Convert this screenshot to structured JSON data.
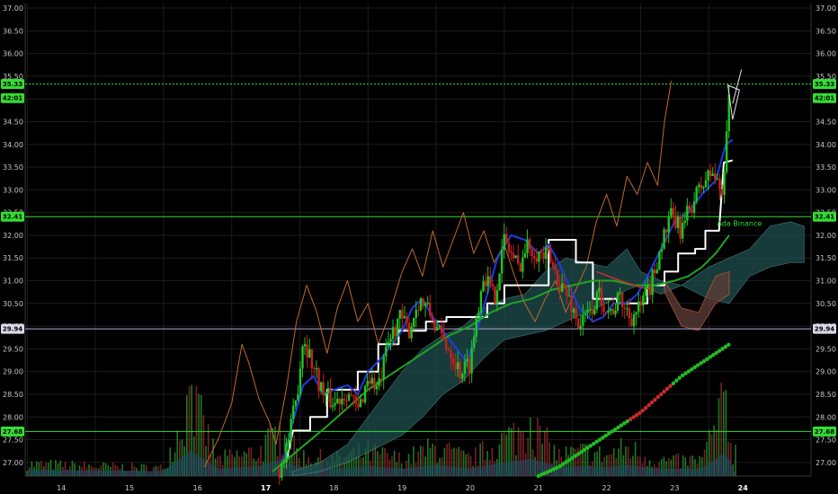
{
  "chart_data": {
    "type": "candlestick",
    "y_axis": {
      "range": [
        26.7,
        37.1
      ],
      "ticks": [
        "37.00",
        "36.50",
        "36.00",
        "35.50",
        "35.00",
        "34.50",
        "34.00",
        "33.50",
        "33.00",
        "32.50",
        "32.00",
        "31.50",
        "31.00",
        "30.50",
        "30.00",
        "29.50",
        "29.00",
        "28.50",
        "28.00",
        "27.50",
        "27.00"
      ]
    },
    "x_axis": {
      "range": [
        13.47,
        25.0
      ],
      "ticks": [
        {
          "label": "14",
          "x": 14,
          "bold": false
        },
        {
          "label": "15",
          "x": 15,
          "bold": false
        },
        {
          "label": "16",
          "x": 16,
          "bold": false
        },
        {
          "label": "17",
          "x": 17,
          "bold": true
        },
        {
          "label": "18",
          "x": 18,
          "bold": false
        },
        {
          "label": "19",
          "x": 19,
          "bold": false
        },
        {
          "label": "20",
          "x": 20,
          "bold": false
        },
        {
          "label": "21",
          "x": 21,
          "bold": false
        },
        {
          "label": "22",
          "x": 22,
          "bold": false
        },
        {
          "label": "23",
          "x": 23,
          "bold": false
        },
        {
          "label": "24",
          "x": 24,
          "bold": true
        }
      ]
    },
    "grid": true,
    "horizontal_lines": [
      {
        "name": "last-price-line",
        "y": 35.33,
        "color": "#33dd33",
        "dashed": true
      },
      {
        "name": "level-32-41",
        "y": 32.41,
        "color": "#33dd33",
        "dashed": false
      },
      {
        "name": "level-29-94",
        "y": 29.94,
        "color": "#b4a8d8",
        "dashed": false
      },
      {
        "name": "level-27-68",
        "y": 27.68,
        "color": "#33dd33",
        "dashed": false
      }
    ],
    "price_badges": [
      {
        "text": "35.33",
        "y": 35.33,
        "bg": "#33dd33",
        "fg": "#000000"
      },
      {
        "text": "42:01",
        "y": 35.02,
        "bg": "#33dd33",
        "fg": "#000000"
      },
      {
        "text": "32.41",
        "y": 32.41,
        "bg": "#33dd33",
        "fg": "#000000"
      },
      {
        "text": "29.94",
        "y": 29.94,
        "bg": "#d8d8e8",
        "fg": "#000000"
      },
      {
        "text": "27.68",
        "y": 27.68,
        "bg": "#33dd33",
        "fg": "#000000"
      }
    ],
    "annotation": {
      "text": "Ada Binance",
      "x": 23.62,
      "y": 32.27,
      "color": "#33dd33"
    },
    "candles_anchor": [
      [
        17.2,
        26.85
      ],
      [
        17.35,
        27.6
      ],
      [
        17.45,
        28.4
      ],
      [
        17.55,
        29.8
      ],
      [
        17.7,
        29.1
      ],
      [
        17.85,
        28.5
      ],
      [
        18.0,
        28.3
      ],
      [
        18.2,
        28.6
      ],
      [
        18.35,
        28.1
      ],
      [
        18.5,
        28.9
      ],
      [
        18.65,
        28.6
      ],
      [
        18.8,
        29.6
      ],
      [
        18.95,
        30.2
      ],
      [
        19.1,
        29.9
      ],
      [
        19.25,
        30.6
      ],
      [
        19.4,
        30.3
      ],
      [
        19.55,
        29.8
      ],
      [
        19.7,
        29.5
      ],
      [
        19.85,
        29.0
      ],
      [
        20.0,
        29.2
      ],
      [
        20.1,
        30.3
      ],
      [
        20.2,
        31.2
      ],
      [
        20.35,
        30.6
      ],
      [
        20.5,
        31.9
      ],
      [
        20.7,
        31.3
      ],
      [
        20.85,
        31.8
      ],
      [
        21.0,
        31.6
      ],
      [
        21.15,
        31.5
      ],
      [
        21.3,
        31.0
      ],
      [
        21.45,
        30.6
      ],
      [
        21.6,
        30.0
      ],
      [
        21.75,
        30.3
      ],
      [
        21.9,
        30.7
      ],
      [
        22.05,
        30.3
      ],
      [
        22.2,
        30.6
      ],
      [
        22.35,
        30.2
      ],
      [
        22.5,
        30.4
      ],
      [
        22.65,
        30.9
      ],
      [
        22.8,
        31.8
      ],
      [
        22.95,
        32.4
      ],
      [
        23.1,
        32.1
      ],
      [
        23.25,
        32.7
      ],
      [
        23.4,
        33.1
      ],
      [
        23.55,
        33.4
      ],
      [
        23.7,
        32.9
      ],
      [
        23.8,
        35.3
      ]
    ],
    "volume_anchor": [
      [
        13.5,
        0.15
      ],
      [
        14.5,
        0.12
      ],
      [
        15.5,
        0.1
      ],
      [
        15.9,
        0.95
      ],
      [
        16.3,
        0.2
      ],
      [
        16.9,
        0.3
      ],
      [
        17.2,
        0.55
      ],
      [
        17.5,
        0.25
      ],
      [
        18.0,
        0.2
      ],
      [
        18.5,
        0.3
      ],
      [
        19.0,
        0.2
      ],
      [
        19.5,
        0.35
      ],
      [
        20.0,
        0.2
      ],
      [
        20.5,
        0.45
      ],
      [
        20.9,
        0.6
      ],
      [
        21.3,
        0.25
      ],
      [
        21.7,
        0.3
      ],
      [
        22.0,
        0.25
      ],
      [
        22.3,
        0.35
      ],
      [
        22.7,
        0.2
      ],
      [
        23.0,
        0.18
      ],
      [
        23.4,
        0.2
      ],
      [
        23.75,
        0.9
      ],
      [
        23.85,
        0.3
      ]
    ],
    "series": [
      {
        "name": "",
        "color": "#c0692a",
        "width": 1,
        "points": [
          [
            16.1,
            26.9
          ],
          [
            16.3,
            27.5
          ],
          [
            16.5,
            28.3
          ],
          [
            16.65,
            29.6
          ],
          [
            16.75,
            29.2
          ],
          [
            16.9,
            28.4
          ],
          [
            17.05,
            27.9
          ],
          [
            17.15,
            27.4
          ],
          [
            17.3,
            28.6
          ],
          [
            17.45,
            30.1
          ],
          [
            17.6,
            30.9
          ],
          [
            17.75,
            30.3
          ],
          [
            17.9,
            29.4
          ],
          [
            18.05,
            30.4
          ],
          [
            18.2,
            31.0
          ],
          [
            18.35,
            30.1
          ],
          [
            18.5,
            30.5
          ],
          [
            18.65,
            29.6
          ],
          [
            18.8,
            30.2
          ],
          [
            19.0,
            31.2
          ],
          [
            19.15,
            31.7
          ],
          [
            19.3,
            31.1
          ],
          [
            19.45,
            32.1
          ],
          [
            19.6,
            31.3
          ],
          [
            19.75,
            31.9
          ],
          [
            19.9,
            32.5
          ],
          [
            20.05,
            31.6
          ],
          [
            20.2,
            32.1
          ],
          [
            20.35,
            31.4
          ],
          [
            20.5,
            31.8
          ],
          [
            20.65,
            31.1
          ],
          [
            20.8,
            30.5
          ],
          [
            20.95,
            30.1
          ],
          [
            21.1,
            30.6
          ],
          [
            21.25,
            31.0
          ],
          [
            21.4,
            30.3
          ],
          [
            21.55,
            30.8
          ],
          [
            21.7,
            31.3
          ],
          [
            21.85,
            32.3
          ],
          [
            22.0,
            32.9
          ],
          [
            22.15,
            32.2
          ],
          [
            22.3,
            33.3
          ],
          [
            22.45,
            32.9
          ],
          [
            22.6,
            33.6
          ],
          [
            22.75,
            33.1
          ],
          [
            22.85,
            34.5
          ],
          [
            22.95,
            35.4
          ]
        ]
      },
      {
        "name": "",
        "color": "#ffffff",
        "width": 2,
        "points": [
          [
            17.3,
            27.0
          ],
          [
            17.4,
            27.7
          ],
          [
            17.65,
            27.7
          ],
          [
            17.65,
            28.0
          ],
          [
            17.9,
            28.0
          ],
          [
            17.9,
            28.6
          ],
          [
            18.35,
            28.6
          ],
          [
            18.35,
            29.0
          ],
          [
            18.65,
            29.0
          ],
          [
            18.65,
            29.6
          ],
          [
            18.95,
            29.6
          ],
          [
            18.95,
            29.9
          ],
          [
            19.35,
            29.9
          ],
          [
            19.35,
            30.1
          ],
          [
            19.65,
            30.1
          ],
          [
            19.65,
            30.2
          ],
          [
            20.25,
            30.2
          ],
          [
            20.25,
            30.5
          ],
          [
            20.5,
            30.5
          ],
          [
            20.5,
            30.9
          ],
          [
            21.15,
            30.9
          ],
          [
            21.15,
            31.9
          ],
          [
            21.55,
            31.9
          ],
          [
            21.55,
            31.4
          ],
          [
            21.8,
            31.4
          ],
          [
            21.8,
            30.6
          ],
          [
            22.15,
            30.6
          ],
          [
            22.15,
            30.5
          ],
          [
            22.6,
            30.5
          ],
          [
            22.6,
            30.9
          ],
          [
            22.85,
            30.9
          ],
          [
            22.85,
            31.2
          ],
          [
            23.05,
            31.2
          ],
          [
            23.05,
            31.6
          ],
          [
            23.3,
            31.6
          ],
          [
            23.3,
            31.7
          ],
          [
            23.45,
            31.7
          ],
          [
            23.45,
            32.1
          ],
          [
            23.65,
            32.1
          ],
          [
            23.72,
            33.6
          ],
          [
            23.85,
            33.65
          ]
        ]
      },
      {
        "name": "",
        "color": "#1a3ce8",
        "width": 2,
        "points": [
          [
            17.25,
            27.0
          ],
          [
            17.4,
            27.9
          ],
          [
            17.55,
            28.7
          ],
          [
            17.7,
            28.9
          ],
          [
            17.85,
            28.5
          ],
          [
            18.0,
            28.6
          ],
          [
            18.2,
            28.7
          ],
          [
            18.35,
            28.5
          ],
          [
            18.5,
            29.0
          ],
          [
            18.7,
            29.3
          ],
          [
            18.85,
            29.6
          ],
          [
            19.0,
            29.9
          ],
          [
            19.15,
            30.4
          ],
          [
            19.3,
            30.6
          ],
          [
            19.45,
            30.2
          ],
          [
            19.6,
            29.9
          ],
          [
            19.8,
            29.5
          ],
          [
            19.95,
            29.2
          ],
          [
            20.1,
            29.9
          ],
          [
            20.25,
            30.7
          ],
          [
            20.4,
            31.5
          ],
          [
            20.6,
            32.0
          ],
          [
            20.8,
            31.9
          ],
          [
            21.0,
            31.6
          ],
          [
            21.15,
            31.8
          ],
          [
            21.3,
            31.4
          ],
          [
            21.45,
            30.9
          ],
          [
            21.6,
            30.4
          ],
          [
            21.8,
            30.1
          ],
          [
            21.95,
            30.2
          ],
          [
            22.1,
            30.5
          ],
          [
            22.3,
            30.5
          ],
          [
            22.45,
            30.7
          ],
          [
            22.6,
            31.1
          ],
          [
            22.8,
            31.7
          ],
          [
            23.0,
            32.3
          ],
          [
            23.2,
            32.5
          ],
          [
            23.4,
            32.9
          ],
          [
            23.6,
            33.2
          ],
          [
            23.75,
            34.0
          ],
          [
            23.85,
            34.1
          ]
        ]
      },
      {
        "name": "",
        "color": "#22a322",
        "width": 2,
        "points": [
          [
            17.1,
            26.8
          ],
          [
            17.5,
            27.3
          ],
          [
            17.9,
            27.8
          ],
          [
            18.2,
            28.2
          ],
          [
            18.5,
            28.6
          ],
          [
            18.8,
            28.9
          ],
          [
            19.1,
            29.2
          ],
          [
            19.4,
            29.5
          ],
          [
            19.7,
            29.8
          ],
          [
            20.0,
            30.0
          ],
          [
            20.3,
            30.3
          ],
          [
            20.6,
            30.5
          ],
          [
            20.9,
            30.6
          ],
          [
            21.2,
            30.8
          ],
          [
            21.5,
            30.9
          ],
          [
            21.8,
            31.0
          ],
          [
            22.1,
            31.0
          ],
          [
            22.4,
            30.9
          ],
          [
            22.7,
            30.9
          ],
          [
            23.0,
            31.0
          ],
          [
            23.2,
            31.1
          ],
          [
            23.4,
            31.3
          ],
          [
            23.6,
            31.6
          ],
          [
            23.8,
            32.0
          ]
        ]
      },
      {
        "name": "",
        "color": "#cc2b2b",
        "width": 1.5,
        "points": [
          [
            21.85,
            31.2
          ],
          [
            22.2,
            31.0
          ],
          [
            22.5,
            30.85
          ],
          [
            22.7,
            30.8
          ]
        ]
      }
    ],
    "dotted_series": {
      "colors": [
        "#22bb22",
        "#cc2b2b"
      ],
      "points": [
        [
          21.0,
          26.7
        ],
        [
          21.3,
          26.9
        ],
        [
          21.6,
          27.2
        ],
        [
          21.9,
          27.5
        ],
        [
          22.2,
          27.8
        ],
        [
          22.5,
          28.1
        ],
        [
          22.8,
          28.5
        ],
        [
          23.1,
          28.9
        ],
        [
          23.4,
          29.2
        ],
        [
          23.6,
          29.4
        ],
        [
          23.8,
          29.6
        ]
      ]
    },
    "cloud": {
      "upper": [
        [
          17.4,
          26.8
        ],
        [
          17.8,
          27.0
        ],
        [
          18.2,
          27.4
        ],
        [
          18.6,
          28.2
        ],
        [
          19.0,
          29.0
        ],
        [
          19.3,
          29.5
        ],
        [
          19.6,
          29.8
        ],
        [
          19.9,
          30.0
        ],
        [
          20.2,
          30.4
        ],
        [
          20.5,
          30.6
        ],
        [
          20.8,
          30.7
        ],
        [
          21.1,
          31.2
        ],
        [
          21.4,
          31.5
        ],
        [
          21.7,
          31.4
        ],
        [
          22.0,
          31.3
        ],
        [
          22.3,
          31.7
        ],
        [
          22.5,
          31.2
        ],
        [
          22.8,
          31.0
        ],
        [
          23.1,
          30.9
        ],
        [
          23.5,
          31.3
        ],
        [
          23.8,
          31.5
        ],
        [
          24.1,
          31.7
        ],
        [
          24.4,
          32.2
        ],
        [
          24.7,
          32.3
        ],
        [
          24.9,
          32.2
        ]
      ],
      "lower": [
        [
          17.4,
          26.7
        ],
        [
          17.8,
          26.8
        ],
        [
          18.2,
          27.0
        ],
        [
          18.6,
          27.3
        ],
        [
          19.0,
          27.6
        ],
        [
          19.3,
          28.0
        ],
        [
          19.6,
          28.5
        ],
        [
          19.9,
          28.8
        ],
        [
          20.2,
          29.3
        ],
        [
          20.5,
          29.7
        ],
        [
          20.8,
          29.8
        ],
        [
          21.1,
          29.9
        ],
        [
          21.4,
          30.1
        ],
        [
          21.7,
          30.3
        ],
        [
          22.0,
          30.5
        ],
        [
          22.3,
          30.8
        ],
        [
          22.5,
          30.9
        ],
        [
          22.8,
          30.7
        ],
        [
          23.1,
          30.9
        ],
        [
          23.5,
          30.6
        ],
        [
          23.8,
          30.5
        ],
        [
          24.1,
          31.1
        ],
        [
          24.4,
          31.3
        ],
        [
          24.7,
          31.4
        ],
        [
          24.9,
          31.4
        ]
      ]
    }
  }
}
